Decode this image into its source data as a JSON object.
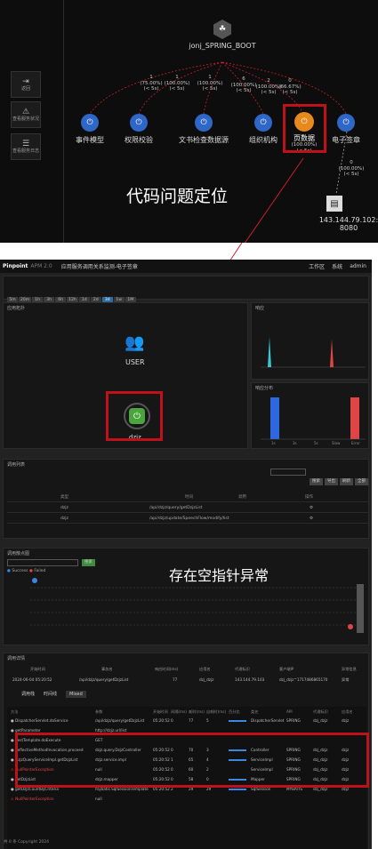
{
  "topology": {
    "root_label": "jonj_SPRING_BOOT",
    "sidebar": [
      {
        "glyph": "⇥",
        "label": "返回"
      },
      {
        "glyph": "⚠",
        "label": "查看服务状况"
      },
      {
        "glyph": "☰",
        "label": "查看服务日志"
      }
    ],
    "nodes": [
      "事件模型",
      "权限校验",
      "文书检查数据源",
      "组织机构",
      "页数据",
      "电子签章"
    ],
    "edges": [
      "1\n(75.00%)\n(< 5s)",
      "1\n(100.00%)\n(< 5s)",
      "1\n(100.00%)\n(< 5s)",
      "6\n(100.00%)\n(< 5s)",
      "2\n(100.00%)\n(< 5s)",
      "0\n(66.67%)\n(< 5s)"
    ],
    "selected_node_value": "(100.00%)\n(< 5s)",
    "leaf_edge": "0\n(100.00%)\n(< 5s)",
    "leaf_label": "143.144.79.102:\n8080",
    "annotation": "代码问题定位"
  },
  "app": {
    "brand": "Pinpoint",
    "version": "APM 2.0",
    "breadcrumb": "应用服务调用关系监测-电子签章",
    "nav_right": [
      "工作区",
      "系统",
      "admin"
    ],
    "time_buttons": [
      "5m",
      "20m",
      "1h",
      "3h",
      "6h",
      "12h",
      "1d",
      "2d",
      "3d",
      "1w",
      "1M"
    ],
    "active_time": "3h",
    "server_map_title": "应用拓扑",
    "user_label": "USER",
    "app_node_label": "dzjz",
    "charts_title1": "响应",
    "charts_title2": "响应分布",
    "bar_labels": [
      "1s",
      "3s",
      "5s",
      "Slow",
      "Error"
    ],
    "table_title": "调用列表",
    "table_headers": [
      "类型",
      "时间",
      "调用",
      "操作"
    ],
    "table_rows": [
      [
        "dzjz",
        "/api/dzjz/query/getDzjzList",
        ""
      ],
      [
        "dzjz",
        "/api/dzjz/update/SpeechFlow/modify/list",
        ""
      ]
    ],
    "table_buttons": [
      "搜索",
      "导出",
      "刷新",
      "全部"
    ],
    "scatter_title": "调用散点图",
    "scatter_legend": [
      "Success",
      "Failed"
    ],
    "scatter_search": "搜索",
    "annotation2": "存在空指针异常",
    "detail_title": "调用详情",
    "detail_headers": [
      "开始时间",
      "事务名",
      "响应时间(ms)",
      "应用名",
      "代理标识",
      "客户端IP",
      "异常信息"
    ],
    "detail_values": [
      "2024-06-04 05:20:52",
      "/api/dzjz/query/getDzjzList",
      "77",
      "dzj_dzjz",
      "143.144.79.103",
      "dzj_dzjz^1717486865170",
      "异常"
    ],
    "detail_tabs": [
      "调用栈",
      "时间线",
      "Mixed"
    ],
    "trace_headers": [
      "方法",
      "参数",
      "开始时间",
      "间隔(ms)",
      "耗时(ms)",
      "自耗时(ms)",
      "百分比",
      "类名",
      "API",
      "代理标识",
      "应用名"
    ],
    "trace_rows": [
      [
        "● DispatcherServlet.doService",
        "/api/dzjz/query/getDzjzList",
        "05:20:52",
        "0",
        "77",
        "5",
        "",
        "DispatcherServlet",
        "SPRING",
        "dzj_dzjz",
        "dzjz"
      ],
      [
        "● getParameter",
        "http://dzjz.url/list",
        "",
        "",
        "",
        "",
        "",
        "",
        "",
        "",
        ""
      ],
      [
        "● RestTemplate.doExecute",
        "GET",
        "",
        "",
        "",
        "",
        "",
        "",
        "",
        "",
        ""
      ],
      [
        "● ReflectiveMethodInvocation.proceed",
        "dzjz.query.DzjzController",
        "05:20:52",
        "0",
        "70",
        "3",
        "",
        "Controller",
        "SPRING",
        "dzj_dzjz",
        "dzjz"
      ],
      [
        "● DzjzQueryServiceImpl.getDzjzList",
        "dzjz.service.impl",
        "05:20:52",
        "1",
        "65",
        "4",
        "",
        "ServiceImpl",
        "SPRING",
        "dzj_dzjz",
        "dzjz"
      ],
      [
        "  ⚠ NullPointerException",
        "null",
        "05:20:52",
        "0",
        "60",
        "2",
        "",
        "ServiceImpl",
        "SPRING",
        "dzj_dzjz",
        "dzjz"
      ],
      [
        "● getDzjzList",
        "dzjz.mapper",
        "05:20:52",
        "0",
        "58",
        "0",
        "",
        "Mapper",
        "SPRING",
        "dzj_dzjz",
        "dzjz"
      ],
      [
        "● getDzjzCountByCriteria",
        "mybatis.SqlSessionTemplate",
        "05:20:52",
        "2",
        "29",
        "29",
        "",
        "SqlSession",
        "MYBATIS",
        "dzj_dzjz",
        "dzjz"
      ],
      [
        "  ⚠ NullPointerException",
        "null",
        "",
        "",
        "",
        "",
        "",
        "",
        "",
        "",
        ""
      ]
    ],
    "footer": "共 0 条 Copyright 2024"
  }
}
